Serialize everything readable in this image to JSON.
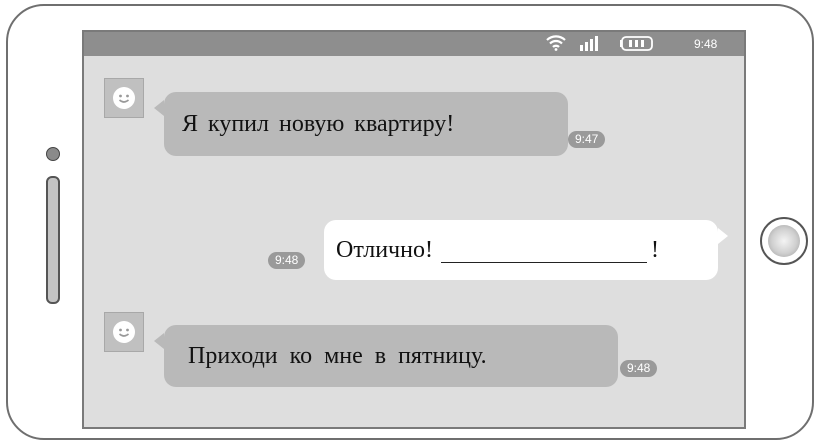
{
  "statusbar": {
    "time": "9:48",
    "icons": [
      "wifi-icon",
      "signal-icon",
      "battery-icon"
    ]
  },
  "messages": [
    {
      "side": "incoming",
      "text": "Я купил новую квартиру!",
      "time": "9:47",
      "avatar": "smiley-icon"
    },
    {
      "side": "outgoing",
      "text_before_blank": "Отлично!",
      "text_after_blank": "!",
      "time": "9:48"
    },
    {
      "side": "incoming",
      "text": "Приходи ко мне в пятницу.",
      "time": "9:48",
      "avatar": "smiley-icon"
    }
  ],
  "colors": {
    "screen_bg": "#dedede",
    "statusbar_bg": "#8e8e8e",
    "incoming_bubble": "#b9b9b9",
    "outgoing_bubble": "#ffffff",
    "time_pill": "#9a9a9a"
  }
}
